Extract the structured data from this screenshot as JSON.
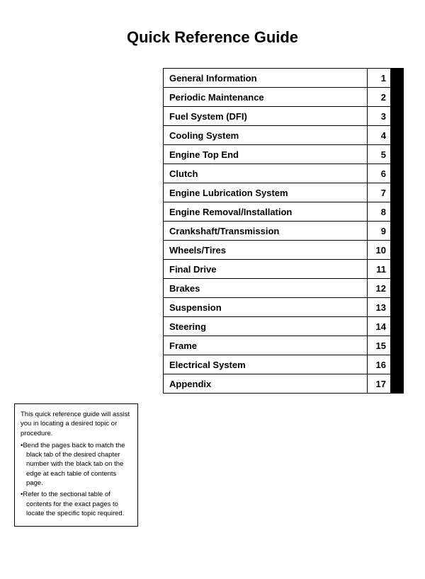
{
  "title": "Quick Reference Guide",
  "toc": {
    "items": [
      {
        "label": "General Information",
        "number": "1"
      },
      {
        "label": "Periodic Maintenance",
        "number": "2"
      },
      {
        "label": "Fuel System (DFI)",
        "number": "3"
      },
      {
        "label": "Cooling System",
        "number": "4"
      },
      {
        "label": "Engine Top End",
        "number": "5"
      },
      {
        "label": "Clutch",
        "number": "6"
      },
      {
        "label": "Engine Lubrication System",
        "number": "7"
      },
      {
        "label": "Engine Removal/Installation",
        "number": "8"
      },
      {
        "label": "Crankshaft/Transmission",
        "number": "9"
      },
      {
        "label": "Wheels/Tires",
        "number": "10"
      },
      {
        "label": "Final Drive",
        "number": "11"
      },
      {
        "label": "Brakes",
        "number": "12"
      },
      {
        "label": "Suspension",
        "number": "13"
      },
      {
        "label": "Steering",
        "number": "14"
      },
      {
        "label": "Frame",
        "number": "15"
      },
      {
        "label": "Electrical System",
        "number": "16"
      },
      {
        "label": "Appendix",
        "number": "17"
      }
    ]
  },
  "info_box": {
    "intro": "This quick reference guide will assist you in locating a desired topic or procedure.",
    "bullet1": "Bend the pages back to match the black tab of the desired chapter number with the black tab on the edge at each table of contents page.",
    "bullet2": "Refer to the sectional table of contents for the exact pages to locate the specific topic required."
  }
}
